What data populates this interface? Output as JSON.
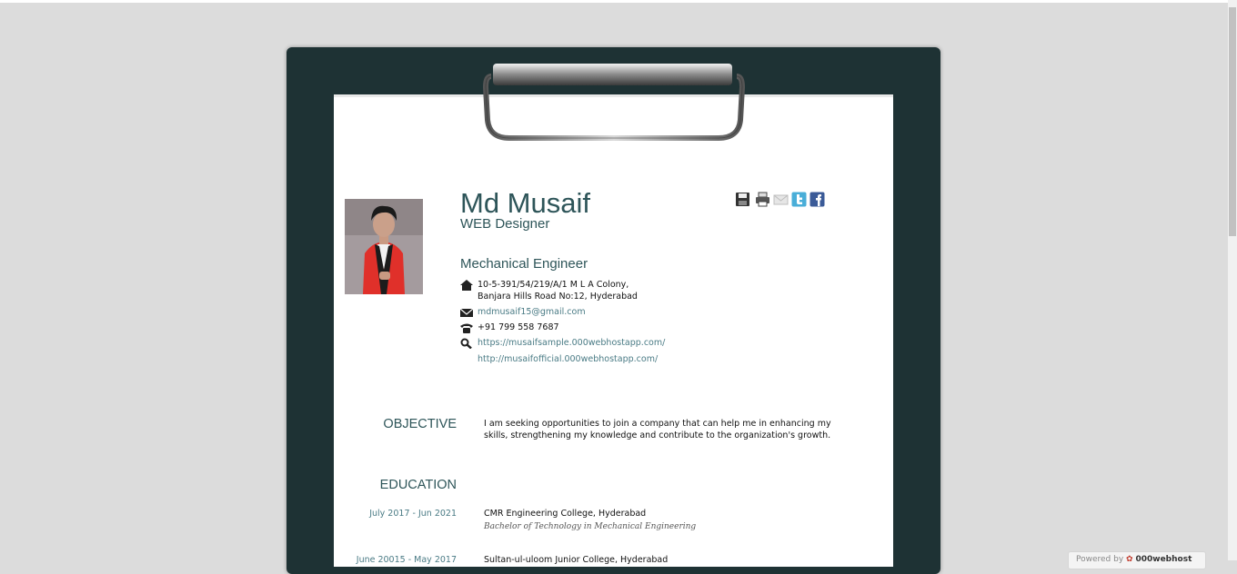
{
  "profile": {
    "name": "Md Musaif",
    "role": "WEB Designer",
    "profession": "Mechanical Engineer",
    "address_line1": "10-5-391/54/219/A/1 M L A Colony,",
    "address_line2": "Banjara Hills Road No:12, Hyderabad",
    "email": "mdmusaif15@gmail.com",
    "phone": "+91 799 558 7687",
    "website1": "https://musaifsample.000webhostapp.com/",
    "website2": "http://musaifofficial.000webhostapp.com/"
  },
  "objective": {
    "title": "OBJECTIVE",
    "line1": "I am seeking opportunities to join a company that can help me in enhancing my",
    "line2": "skills, strengthening my knowledge and contribute to the organization's growth."
  },
  "education": {
    "title": "EDUCATION",
    "items": [
      {
        "date": "July 2017 - Jun 2021",
        "school": "CMR Engineering College, Hyderabad",
        "degree": "Bachelor of Technology in Mechanical Engineering"
      },
      {
        "date": "June 20015 - May 2017",
        "school": "Sultan-ul-uloom Junior College, Hyderabad",
        "degree": ""
      }
    ]
  },
  "share_icons": [
    "save-icon",
    "print-icon",
    "email-icon",
    "twitter-icon",
    "facebook-icon"
  ],
  "footer": {
    "powered_label": "Powered by",
    "brand": "000webhost"
  },
  "colors": {
    "board": "#1e3234",
    "accent": "#2e5559",
    "link": "#4a7b85",
    "background": "#dcdcdc"
  }
}
